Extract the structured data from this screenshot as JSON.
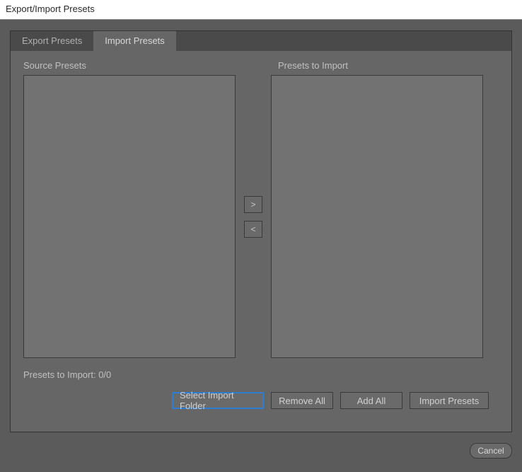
{
  "title": "Export/Import Presets",
  "tabs": {
    "export": "Export Presets",
    "import": "Import Presets"
  },
  "labels": {
    "source": "Source Presets",
    "target": "Presets to Import",
    "status": "Presets to Import: 0/0"
  },
  "moveButtons": {
    "right": ">",
    "left": "<"
  },
  "buttons": {
    "selectFolder": "Select Import Folder",
    "removeAll": "Remove All",
    "addAll": "Add All",
    "importPresets": "Import Presets",
    "cancel": "Cancel"
  }
}
